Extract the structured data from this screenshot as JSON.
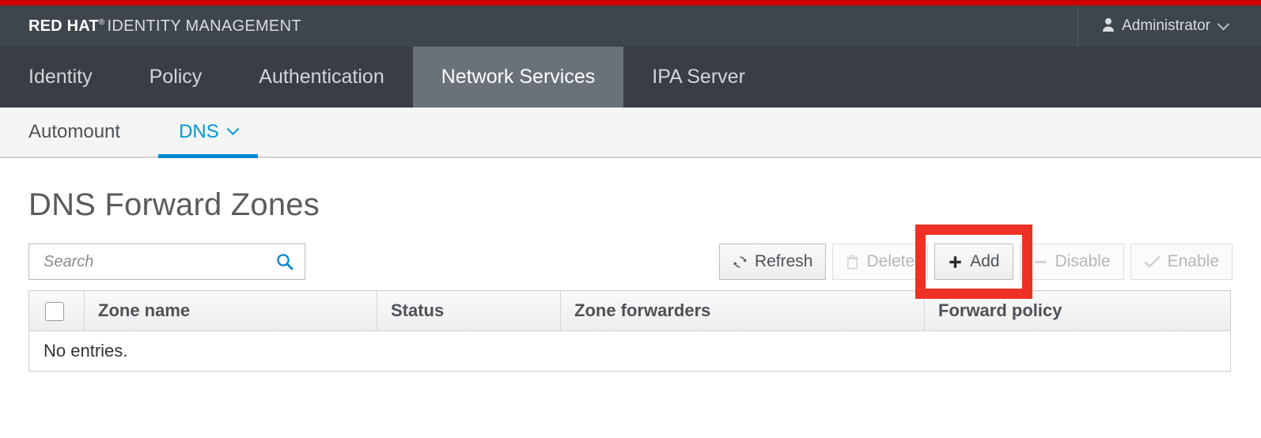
{
  "masthead": {
    "brand_strong": "RED HAT",
    "brand_tm": "®",
    "brand_rest": "IDENTITY MANAGEMENT",
    "user_label": "Administrator",
    "user_icon": "user-icon",
    "caret_icon": "chevron-down-icon"
  },
  "primary_nav": {
    "items": [
      {
        "label": "Identity",
        "active": false
      },
      {
        "label": "Policy",
        "active": false
      },
      {
        "label": "Authentication",
        "active": false
      },
      {
        "label": "Network Services",
        "active": true
      },
      {
        "label": "IPA Server",
        "active": false
      }
    ]
  },
  "secondary_nav": {
    "items": [
      {
        "label": "Automount",
        "active": false,
        "caret": false
      },
      {
        "label": "DNS",
        "active": true,
        "caret": true
      }
    ]
  },
  "page": {
    "title": "DNS Forward Zones"
  },
  "search": {
    "value": "",
    "placeholder": "Search",
    "icon": "search-icon"
  },
  "toolbar": {
    "buttons": [
      {
        "label": "Refresh",
        "icon": "refresh-icon",
        "disabled": false
      },
      {
        "label": "Delete",
        "icon": "trash-icon",
        "disabled": true
      },
      {
        "label": "Add",
        "icon": "plus-icon",
        "disabled": false
      },
      {
        "label": "Disable",
        "icon": "minus-icon",
        "disabled": true
      },
      {
        "label": "Enable",
        "icon": "check-icon",
        "disabled": true
      }
    ],
    "highlight": {
      "target_label": "Add",
      "color": "#ee3124"
    }
  },
  "table": {
    "select_all_checkbox": "unchecked",
    "columns": [
      "Zone name",
      "Status",
      "Zone forwarders",
      "Forward policy"
    ],
    "rows": [],
    "empty_message": "No entries."
  },
  "colors": {
    "brand_red": "#cc0000",
    "masthead_bg": "#3f454c",
    "nav_bg": "#383e44",
    "nav_active_bg": "#6a7178",
    "subnav_bg": "#f5f5f5",
    "accent_blue": "#0088ce",
    "highlight_red": "#ee3124"
  }
}
